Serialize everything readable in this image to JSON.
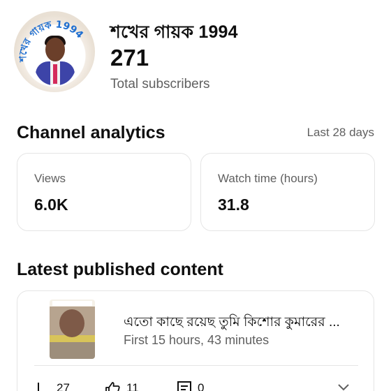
{
  "channel": {
    "name": "শখের গায়ক 1994",
    "subscriber_count": "271",
    "subscriber_label": "Total subscribers",
    "avatar_ring_text": "শখের গায়ক 1994"
  },
  "analytics": {
    "title": "Channel analytics",
    "range": "Last 28 days",
    "metrics": [
      {
        "label": "Views",
        "value": "6.0K"
      },
      {
        "label": "Watch time (hours)",
        "value": "31.8"
      }
    ]
  },
  "latest": {
    "title": "Latest published content",
    "video": {
      "title": "এতো কাছে রয়েছ তুমি কিশোর কুমারের ...",
      "meta": "First 15 hours, 43 minutes",
      "stats": {
        "views": "27",
        "likes": "11",
        "comments": "0"
      }
    }
  },
  "colors": {
    "text_primary": "#0f0f0f",
    "text_secondary": "#606060",
    "border": "#e5e5e5",
    "avatar_ring": "#1f6fd1"
  },
  "icons": [
    "views-icon",
    "like-icon",
    "comments-icon",
    "expand-chevron-icon"
  ]
}
